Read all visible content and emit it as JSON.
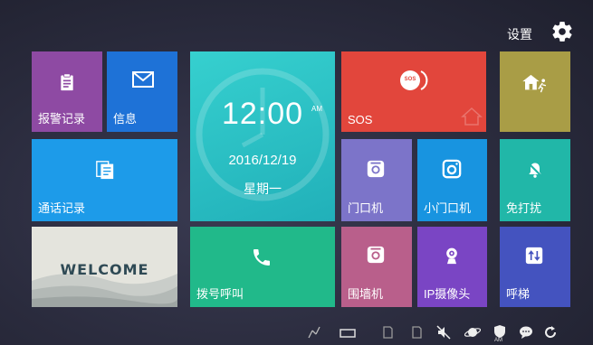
{
  "header": {
    "settings_label": "设置"
  },
  "clock": {
    "time": "12:00",
    "ampm": "AM",
    "date": "2016/12/19",
    "weekday": "星期一"
  },
  "tiles": {
    "alarm_log": "报警记录",
    "messages": "信息",
    "sos": "SOS",
    "sos_badge": "SOS",
    "call_log": "通话记录",
    "door_station": "门口机",
    "small_door_station": "小门口机",
    "dnd": "免打扰",
    "welcome": "WELCOME",
    "dial": "拨号呼叫",
    "wall_station": "围墙机",
    "ip_camera": "IP摄像头",
    "elevator": "呼梯"
  },
  "status": {
    "am_label": "AM"
  },
  "colors": {
    "purple": "#8e4aa3",
    "blue": "#1e72d7",
    "teal": "#2bc3c6",
    "red": "#e2463c",
    "olive": "#a99d46",
    "sky": "#1d9be9",
    "lavender": "#7c74c9",
    "azure": "#1894e0",
    "turquoise": "#21b7a8",
    "green": "#21b98a",
    "mauve": "#b95f8b",
    "violet": "#7a45c4",
    "indigo": "#4453bf"
  },
  "icons": [
    "clipboard-icon",
    "envelope-icon",
    "sos-icon",
    "house-running-icon",
    "document-icon",
    "camera-icon",
    "bell-off-icon",
    "phone-icon",
    "webcam-icon",
    "elevator-icon",
    "gear-icon"
  ]
}
